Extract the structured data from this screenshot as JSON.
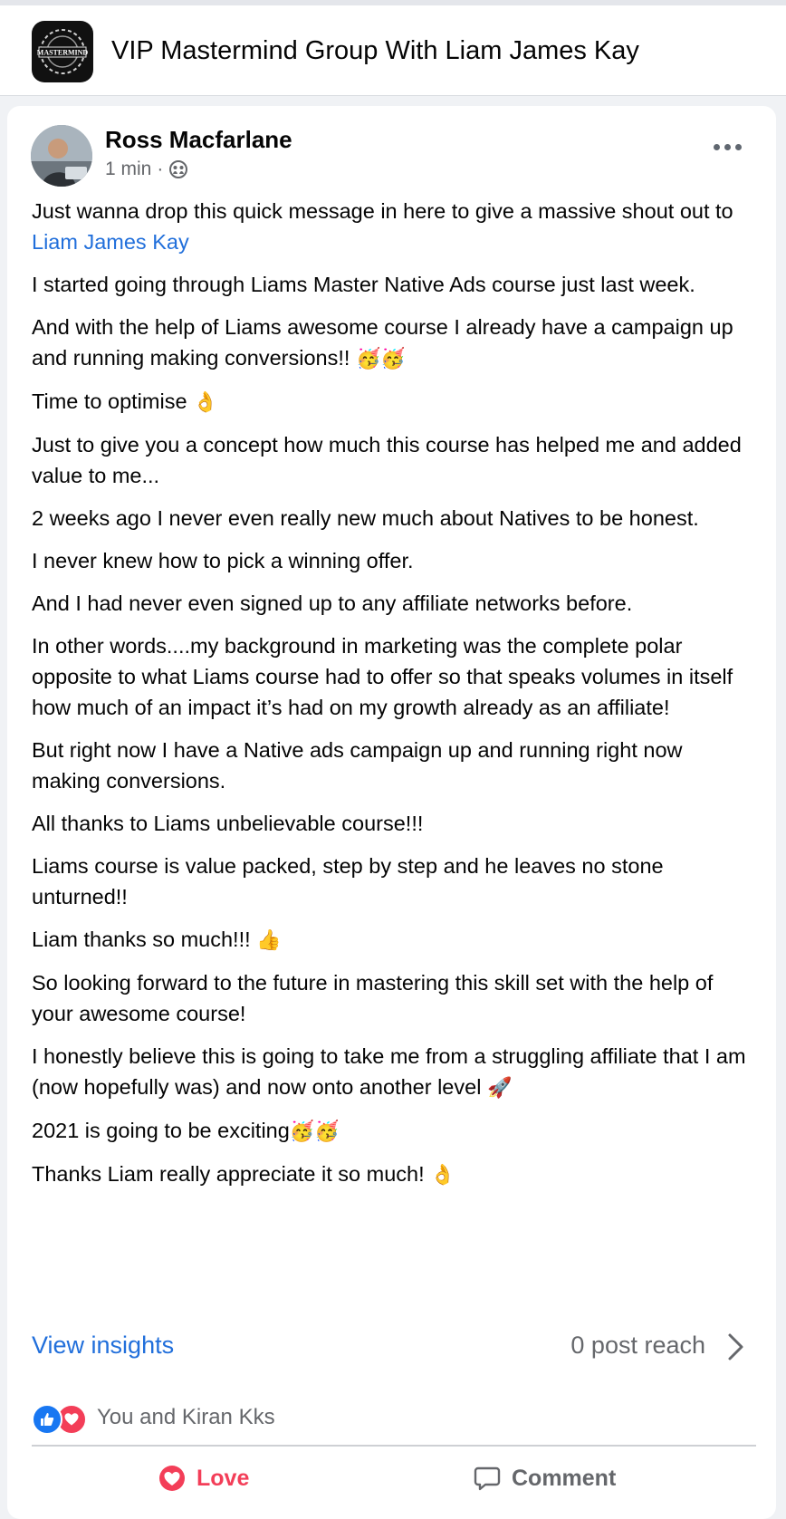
{
  "group": {
    "title": "VIP Mastermind Group With Liam James Kay",
    "logo_text": "MASTERMIND"
  },
  "post": {
    "author": "Ross Macfarlane",
    "time": "1 min",
    "separator": "·",
    "privacy_icon": "group-audience-icon",
    "paragraphs": {
      "p0": "Just wanna drop this quick message in here to give a massive shout out to ",
      "p0_mention": "Liam James Kay",
      "p1": "I started going through Liams Master Native Ads course just last week.",
      "p2": "And with the help of Liams awesome course I already have a campaign up and running making conversions!! ",
      "p2_emoji": "🥳🥳",
      "p3": "Time to optimise ",
      "p3_emoji": "👌",
      "p4": "Just to give you a concept how much this course has helped me and added value to me...",
      "p5": "2 weeks ago I never even really new much about Natives to be honest.",
      "p6": "I never knew how to pick a winning offer.",
      "p7": "And I had never even signed up to any affiliate networks before.",
      "p8": "In other words....my background in marketing was the complete polar opposite to what Liams course had to offer so that speaks volumes in itself how much of an impact it’s had on my growth already as an affiliate!",
      "p9": "But right now I have a Native ads campaign up and running right now making conversions.",
      "p10": "All thanks to Liams unbelievable course!!!",
      "p11": "Liams course is value packed, step by step and he leaves no stone unturned!!",
      "p12": "Liam thanks so much!!! ",
      "p12_emoji": "👍",
      "p13": "So looking forward to the future in mastering this skill set with the help of your awesome course!",
      "p14": "I honestly believe this is going to take me from a struggling affiliate that I am (now hopefully was) and now onto another level ",
      "p14_emoji": "🚀",
      "p15": "2021 is going to be exciting",
      "p15_emoji": "🥳🥳",
      "p16": "Thanks Liam really appreciate it so much! ",
      "p16_emoji": "👌"
    }
  },
  "insights": {
    "view_label": "View insights",
    "reach_label": "0 post reach"
  },
  "reactions": {
    "icons": [
      "like-icon",
      "love-icon"
    ],
    "summary": "You and Kiran Kks"
  },
  "actions": {
    "love_label": "Love",
    "comment_label": "Comment"
  },
  "colors": {
    "link": "#216fdb",
    "love": "#f33e58",
    "like": "#1877f2",
    "muted": "#65676b"
  }
}
